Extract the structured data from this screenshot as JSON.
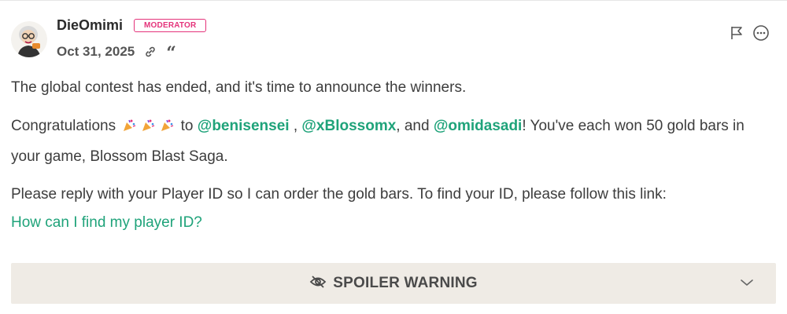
{
  "post": {
    "author": "DieOmimi",
    "badge": "MODERATOR",
    "date": "Oct 31, 2025",
    "icons": {
      "avatar": "avatar-cartoon",
      "permalink": "link-icon",
      "quote": "quote-icon",
      "flag": "flag-icon",
      "more": "more-options-icon"
    },
    "colors": {
      "mention": "#1fa37a",
      "badge": "#e4337a",
      "spoiler_bg": "#efebe5"
    },
    "paragraph1": "The global contest has ended, and it's time to announce the winners.",
    "paragraph2": {
      "prefix": "Congratulations",
      "to": "to",
      "mention1": "@benisensei",
      "sep1": ",",
      "mention2": "@xBlossomx",
      "sep2": ", and",
      "mention3": "@omidasadi",
      "suffix": "! You've each won 50 gold bars in your game, Blossom Blast Saga."
    },
    "paragraph3": {
      "text": "Please reply with your Player ID so I can order the gold bars. To find your ID, please follow this link:",
      "link": "How can I find my player ID?"
    },
    "spoiler": {
      "label": "SPOILER WARNING"
    },
    "quote_glyph": "“"
  }
}
